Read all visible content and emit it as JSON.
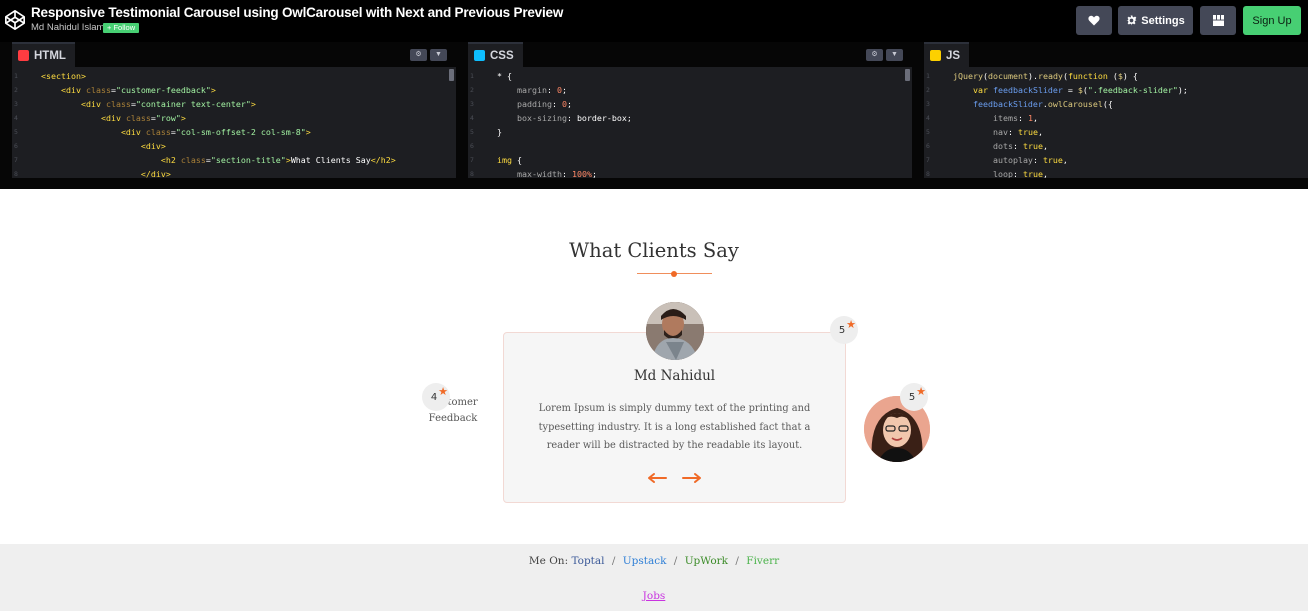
{
  "header": {
    "title": "Responsive Testimonial Carousel using OwlCarousel with Next and Previous Preview",
    "author": "Md Nahidul Islam",
    "follow_label": "+ Follow",
    "settings_label": "Settings",
    "signup_label": "Sign Up"
  },
  "editors": {
    "html": {
      "tab_label": "HTML",
      "line_numbers": [
        "1",
        "2",
        "3",
        "4",
        "5",
        "6",
        "7",
        "8"
      ],
      "lines": [
        "<section>",
        "    <div class=\"customer-feedback\">",
        "        <div class=\"container text-center\">",
        "            <div class=\"row\">",
        "                <div class=\"col-sm-offset-2 col-sm-8\">",
        "                    <div>",
        "                        <h2 class=\"section-title\">What Clients Say</h2>",
        "                    </div>"
      ]
    },
    "css": {
      "tab_label": "CSS",
      "line_numbers": [
        "1",
        "2",
        "3",
        "4",
        "5",
        "6",
        "7",
        "8"
      ],
      "lines": [
        "* {",
        "    margin: 0;",
        "    padding: 0;",
        "    box-sizing: border-box;",
        "}",
        "",
        "img {",
        "    max-width: 100%;"
      ]
    },
    "js": {
      "tab_label": "JS",
      "line_numbers": [
        "1",
        "2",
        "3",
        "4",
        "5",
        "6",
        "7",
        "8"
      ],
      "lines": [
        "jQuery(document).ready(function ($) {",
        "    var feedbackSlider = $(\".feedback-slider\");",
        "    feedbackSlider.owlCarousel({",
        "        items: 1,",
        "        nav: true,",
        "        dots: true,",
        "        autoplay: true,",
        "        loop: true,"
      ]
    }
  },
  "preview": {
    "section_title": "What Clients Say",
    "active": {
      "name": "Md Nahidul",
      "rating": "5",
      "quote": "Lorem Ipsum is simply dummy text of the printing and typesetting industry. It is a long established fact that a reader will be distracted by the readable its layout."
    },
    "prev": {
      "rating": "4",
      "text_line1": "Customer",
      "text_line2": "Feedback"
    },
    "next": {
      "rating": "5"
    }
  },
  "footer": {
    "me_on_label": "Me On:",
    "links": [
      "Toptal",
      "Upstack",
      "UpWork",
      "Fiverr"
    ],
    "separator": "/",
    "jobs_label": "Jobs"
  },
  "colors": {
    "accent_orange": "#f06a27",
    "signup_green": "#47cf73",
    "header_bg": "#000000",
    "editor_bg": "#1d1e22"
  }
}
